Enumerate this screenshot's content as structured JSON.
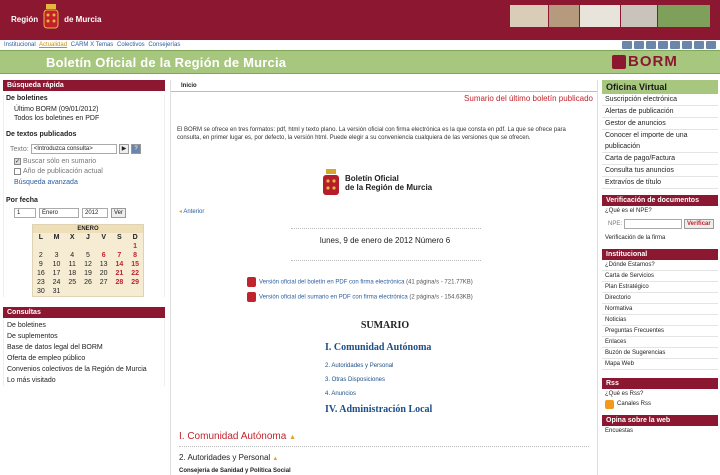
{
  "header": {
    "region": "Región",
    "murcia": "de Murcia"
  },
  "topnav": {
    "items": [
      "Institucional",
      "Actualidad",
      "CARM X Temas",
      "Colectivos",
      "Consejerías"
    ],
    "selected": "Actualidad"
  },
  "banner": {
    "title": "Boletín Oficial de la Región de Murcia",
    "logo": "BORM"
  },
  "left": {
    "quick": "Búsqueda rápida",
    "boletines": "De boletines",
    "ultimo": "Último BORM (09/01/2012)",
    "todos": "Todos los boletines en PDF",
    "textos": "De textos publicados",
    "texto_label": "Texto:",
    "texto_placeholder": "<Introduzca consulta>",
    "solo_sumario": "Buscar sólo en sumario",
    "anio_actual": "Año de publicación actual",
    "avanzada": "Búsqueda avanzada",
    "por_fecha": "Por fecha",
    "day": "1",
    "month": "Enero",
    "year": "2012",
    "ver": "Ver",
    "cal_month": "ENERO",
    "cal_days": [
      "L",
      "M",
      "X",
      "J",
      "V",
      "S",
      "D"
    ],
    "cal_rows": [
      [
        "",
        "",
        "",
        "",
        "",
        "",
        "1"
      ],
      [
        "2",
        "3",
        "4",
        "5",
        "6",
        "7",
        "8"
      ],
      [
        "9",
        "10",
        "11",
        "12",
        "13",
        "14",
        "15"
      ],
      [
        "16",
        "17",
        "18",
        "19",
        "20",
        "21",
        "22"
      ],
      [
        "23",
        "24",
        "25",
        "26",
        "27",
        "28",
        "29"
      ],
      [
        "30",
        "31",
        "",
        "",
        "",
        "",
        ""
      ]
    ],
    "consultas": "Consultas",
    "links": [
      "De boletines",
      "De suplementos",
      "Base de datos legal del BORM",
      "Oferta de empleo público",
      "Convenios colectivos de la Región de Murcia",
      "Lo más visitado"
    ]
  },
  "center": {
    "crumb": "Inicio",
    "summary_link": "Sumario del último boletín publicado",
    "intro": "El BORM se ofrece en tres formatos: pdf, html y texto plano. La versión oficial con firma electrónica es la que consta en pdf. La que se ofrece para consulta, en primer lugar es, por defecto, la versión html. Puede elegir a su conveniencia cualquiera de las versiones que se ofrecen.",
    "seal_line1": "Boletín Oficial",
    "seal_line2": "de la Región de Murcia",
    "anterior": "Anterior",
    "fecha": "lunes, 9 de enero de 2012 Número 6",
    "pdf1": "Versión oficial del boletín en PDF con firma electrónica",
    "pdf1_info": "(41 página/s - 721.77KB)",
    "pdf2": "Versión oficial del sumario en PDF con firma electrónica",
    "pdf2_info": "(2 página/s - 154.63KB)",
    "sumario": "SUMARIO",
    "sec1": "I. Comunidad Autónoma",
    "sub1": "2. Autoridades y Personal",
    "sub2": "3. Otras Disposiciones",
    "sub3": "4. Anuncios",
    "sec4": "IV. Administración Local",
    "big": "I. Comunidad Autónoma",
    "aut": "2. Autoridades y Personal",
    "cons": "Consejería de Sanidad y Política Social"
  },
  "right": {
    "oficina": "Oficina Virtual",
    "ov_links": [
      "Suscripción electrónica",
      "Alertas de publicación",
      "Gestor de anuncios",
      "Conocer el importe de una publicación",
      "Carta de pago/Factura",
      "Consulta tus anuncios",
      "Extravíos de título"
    ],
    "verif": "Verificación de documentos",
    "que_npe": "¿Qué es el NPE?",
    "npe_label": "NPE:",
    "verificar": "Verificar",
    "verif_firma": "Verificación de la firma",
    "institucional": "Institucional",
    "inst_links": [
      "¿Dónde Estamos?",
      "Carta de Servicios",
      "Plan Estratégico",
      "Directorio",
      "Normativa",
      "Noticias",
      "Preguntas Frecuentes",
      "Enlaces",
      "Buzón de Sugerencias",
      "Mapa Web"
    ],
    "rss": "Rss",
    "que_rss": "¿Qué es Rss?",
    "canales": "Canales Rss",
    "opina": "Opina sobre la web",
    "encuestas": "Encuestas"
  }
}
